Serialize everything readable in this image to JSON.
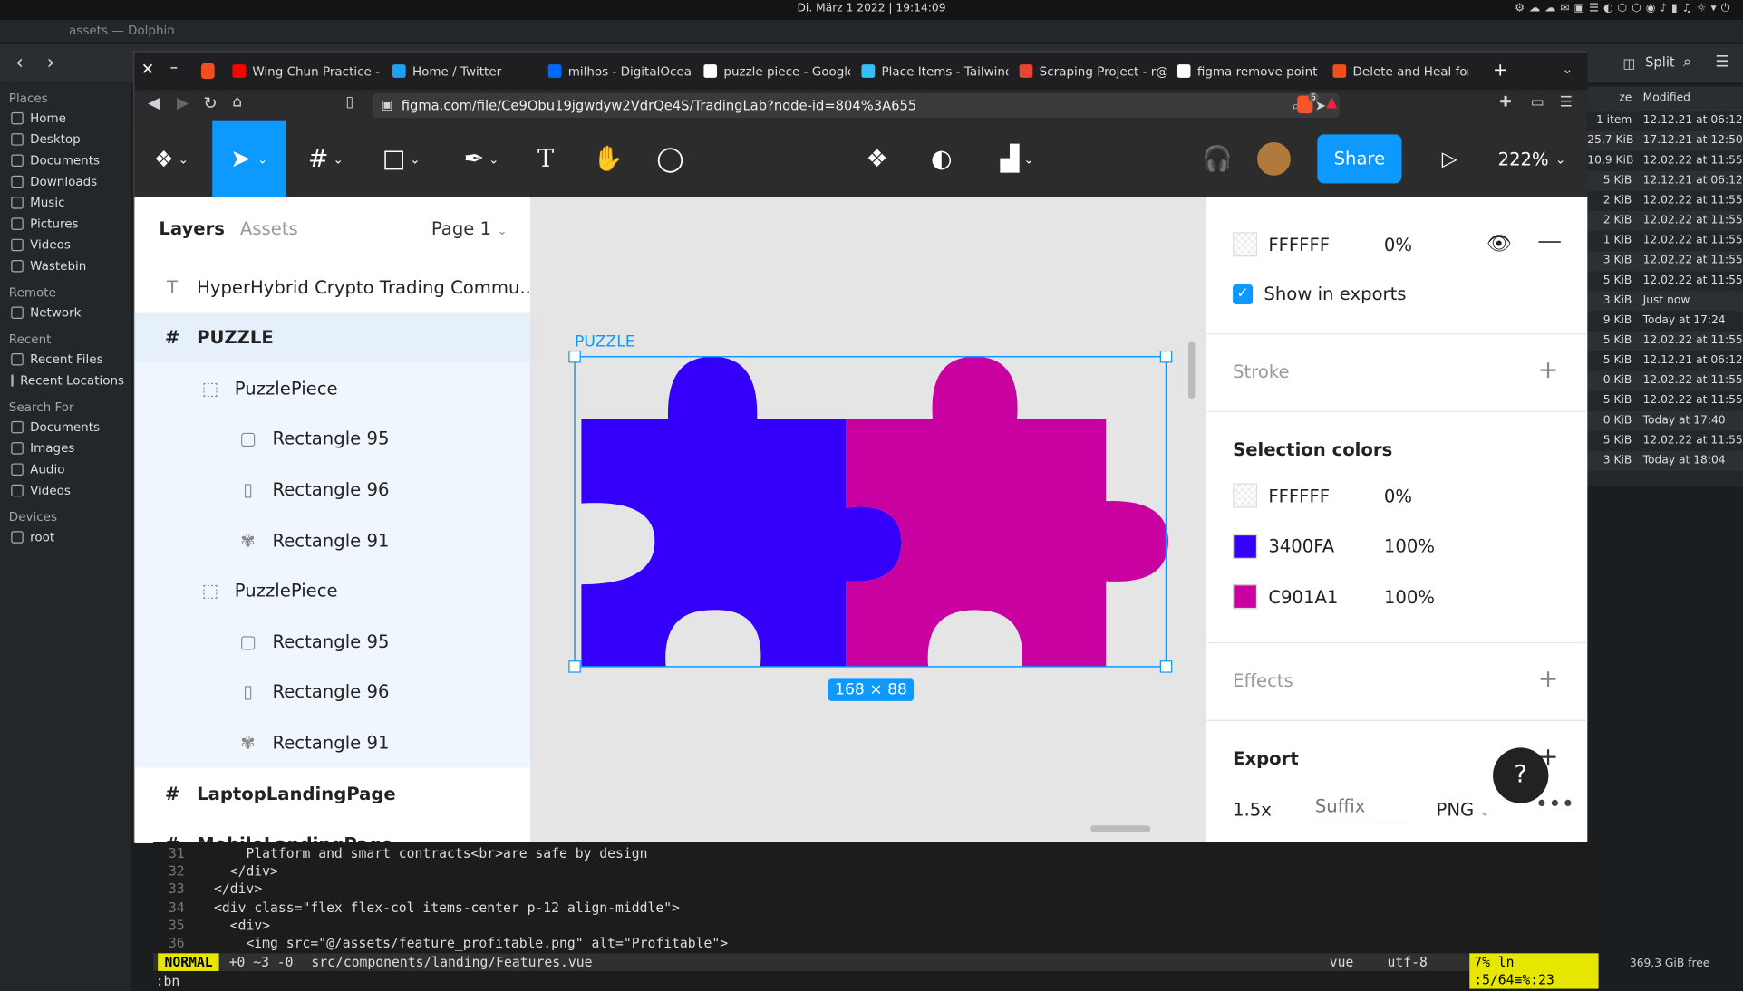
{
  "system": {
    "clock": "Di. März 1 2022 | 19:14:09",
    "disk_free": "369,3 GiB free"
  },
  "dolphin": {
    "window_title": "assets — Dolphin",
    "split_label": "Split",
    "places": [
      {
        "section": "Places",
        "items": [
          "Home",
          "Desktop",
          "Documents",
          "Downloads",
          "Music",
          "Pictures",
          "Videos",
          "Wastebin"
        ]
      },
      {
        "section": "Remote",
        "items": [
          "Network"
        ]
      },
      {
        "section": "Recent",
        "items": [
          "Recent Files",
          "Recent Locations"
        ]
      },
      {
        "section": "Search For",
        "items": [
          "Documents",
          "Images",
          "Audio",
          "Videos"
        ]
      },
      {
        "section": "Devices",
        "items": [
          "root"
        ]
      }
    ],
    "columns": {
      "size": "ze",
      "modified": "Modified"
    },
    "files": [
      [
        "1 item",
        "12.12.21 at 06:12"
      ],
      [
        "25,7 KiB",
        "17.12.21 at 12:50"
      ],
      [
        "10,9 KiB",
        "12.02.22 at 11:55"
      ],
      [
        "5 KiB",
        "12.12.21 at 06:12"
      ],
      [
        "2 KiB",
        "12.02.22 at 11:55"
      ],
      [
        "2 KiB",
        "12.02.22 at 11:55"
      ],
      [
        "1 KiB",
        "12.02.22 at 11:55"
      ],
      [
        "3 KiB",
        "12.02.22 at 11:55"
      ],
      [
        "5 KiB",
        "12.02.22 at 11:55"
      ],
      [
        "3 KiB",
        "Just now"
      ],
      [
        "9 KiB",
        "Today at 17:24"
      ],
      [
        "5 KiB",
        "12.02.22 at 11:55"
      ],
      [
        "5 KiB",
        "12.12.21 at 06:12"
      ],
      [
        "0 KiB",
        "12.02.22 at 11:55"
      ],
      [
        "5 KiB",
        "12.02.22 at 11:55"
      ],
      [
        "0 KiB",
        "Today at 17:40"
      ],
      [
        "5 KiB",
        "12.02.22 at 11:55"
      ],
      [
        "3 KiB",
        "Today at 18:04"
      ]
    ]
  },
  "browser": {
    "url": "figma.com/file/Ce9Obu19jgwdyw2VdrQe4S/TradingLab?node-id=804%3A655",
    "tabs": [
      "Wing Chun Practice - Yo",
      "Home / Twitter",
      "milhos - DigitalOcean",
      "puzzle piece - Google S",
      "Place Items - Tailwind C",
      "Scraping Project - r@m",
      "figma remove point in",
      "Delete and Heal for Ve"
    ],
    "ext_badge": "5"
  },
  "figma": {
    "zoom": "222%",
    "share": "Share",
    "layers_tab": "Layers",
    "assets_tab": "Assets",
    "page": "Page 1",
    "layers": [
      "HyperHybrid Crypto Trading Commu...",
      "PUZZLE",
      "PuzzlePiece",
      "Rectangle 95",
      "Rectangle 96",
      "Rectangle 91",
      "PuzzlePiece",
      "Rectangle 95",
      "Rectangle 96",
      "Rectangle 91",
      "LaptopLandingPage",
      "MobileLandingPage"
    ],
    "frame_label": "PUZZLE",
    "dimensions": "168 × 88",
    "fill": {
      "hex": "FFFFFF",
      "opacity": "0%",
      "show_exports": "Show in exports"
    },
    "stroke_label": "Stroke",
    "selection_colors_label": "Selection colors",
    "selection_colors": [
      {
        "hex": "FFFFFF",
        "opacity": "0%",
        "color": "#ffffff"
      },
      {
        "hex": "3400FA",
        "opacity": "100%",
        "color": "#3400fa"
      },
      {
        "hex": "C901A1",
        "opacity": "100%",
        "color": "#c901a1"
      }
    ],
    "effects_label": "Effects",
    "export_label": "Export",
    "export": {
      "scale": "1.5x",
      "suffix_placeholder": "Suffix",
      "format": "PNG"
    }
  },
  "vim": {
    "lines": [
      {
        "n": "31",
        "t": "      Platform and smart contracts<br>are safe by design"
      },
      {
        "n": "32",
        "t": "    </div>"
      },
      {
        "n": "33",
        "t": "  </div>"
      },
      {
        "n": "34",
        "t": "  <div class=\"flex flex-col items-center p-12 align-middle\">"
      },
      {
        "n": "35",
        "t": "    <div>"
      },
      {
        "n": "36",
        "t": "      <img src=\"@/assets/feature_profitable.png\" alt=\"Profitable\">"
      }
    ],
    "mode": "NORMAL",
    "diff": "+0 ~3 -0",
    "file": "src/components/landing/Features.vue",
    "ft": "vue",
    "enc": "utf-8",
    "pos": "7% ln :5/64≡%:23",
    "cmd": ":bn"
  }
}
